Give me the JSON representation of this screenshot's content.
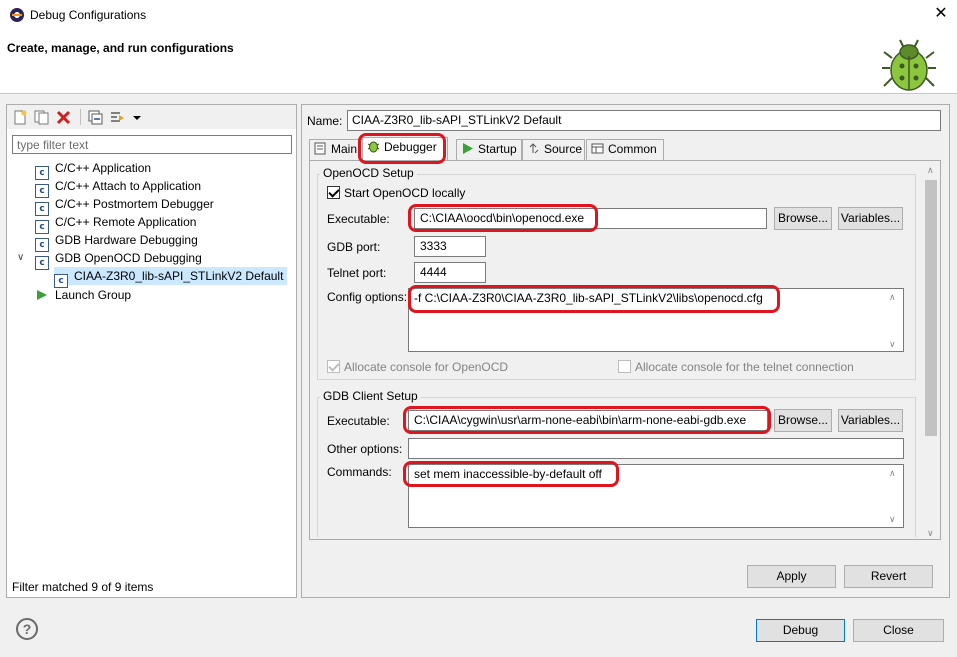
{
  "window": {
    "title": "Debug Configurations",
    "close_glyph": "✕"
  },
  "banner": {
    "title": "Create, manage, and run configurations",
    "icon": "bug-icon"
  },
  "left": {
    "toolbar_icons": [
      "new-config-icon",
      "duplicate-icon",
      "delete-icon",
      "collapse-all-icon",
      "filter-icon",
      "dropdown-arrow-icon"
    ],
    "filter_placeholder": "type filter text",
    "tree": [
      {
        "label": "C/C++ Application",
        "icon": "c-config-icon",
        "level": 1
      },
      {
        "label": "C/C++ Attach to Application",
        "icon": "c-config-icon",
        "level": 1
      },
      {
        "label": "C/C++ Postmortem Debugger",
        "icon": "c-config-icon",
        "level": 1
      },
      {
        "label": "C/C++ Remote Application",
        "icon": "c-config-icon",
        "level": 1
      },
      {
        "label": "GDB Hardware Debugging",
        "icon": "c-config-icon",
        "level": 1
      },
      {
        "label": "GDB OpenOCD Debugging",
        "icon": "c-config-icon",
        "level": 1,
        "expanded": true
      },
      {
        "label": "CIAA-Z3R0_lib-sAPI_STLinkV2 Default",
        "icon": "c-config-icon",
        "level": 2,
        "selected": true
      },
      {
        "label": "Launch Group",
        "icon": "launch-group-icon",
        "level": 1
      }
    ],
    "filter_status": "Filter matched 9 of 9 items"
  },
  "right": {
    "name_label": "Name:",
    "name_value": "CIAA-Z3R0_lib-sAPI_STLinkV2 Default",
    "tabs": [
      {
        "label": "Main",
        "icon": "main-tab-icon"
      },
      {
        "label": "Debugger",
        "icon": "debugger-tab-icon",
        "active": true
      },
      {
        "label": "Startup",
        "icon": "startup-tab-icon"
      },
      {
        "label": "Source",
        "icon": "source-tab-icon"
      },
      {
        "label": "Common",
        "icon": "common-tab-icon"
      }
    ],
    "openocd": {
      "group_title": "OpenOCD Setup",
      "start_locally_label": "Start OpenOCD locally",
      "start_locally_checked": true,
      "executable_label": "Executable:",
      "executable_value": "C:\\CIAA\\oocd\\bin\\openocd.exe",
      "browse_label": "Browse...",
      "variables_label": "Variables...",
      "gdb_port_label": "GDB port:",
      "gdb_port_value": "3333",
      "telnet_port_label": "Telnet port:",
      "telnet_port_value": "4444",
      "config_label": "Config options:",
      "config_value": "-f C:\\CIAA-Z3R0\\CIAA-Z3R0_lib-sAPI_STLinkV2\\libs\\openocd.cfg",
      "alloc_console_label": "Allocate console for OpenOCD",
      "alloc_console_checked": true,
      "alloc_telnet_label": "Allocate console for the telnet connection",
      "alloc_telnet_checked": false
    },
    "gdb_client": {
      "group_title": "GDB Client Setup",
      "executable_label": "Executable:",
      "executable_value": "C:\\CIAA\\cygwin\\usr\\arm-none-eabi\\bin\\arm-none-eabi-gdb.exe",
      "browse_label": "Browse...",
      "variables_label": "Variables...",
      "other_options_label": "Other options:",
      "other_options_value": "",
      "commands_label": "Commands:",
      "commands_value": "set mem inaccessible-by-default off"
    },
    "apply_label": "Apply",
    "revert_label": "Revert"
  },
  "footer": {
    "help_glyph": "?",
    "debug_label": "Debug",
    "close_label": "Close"
  },
  "colors": {
    "highlight_ring": "#e0141e",
    "selection": "#cce8ff",
    "default_button_border": "#0078d7"
  }
}
